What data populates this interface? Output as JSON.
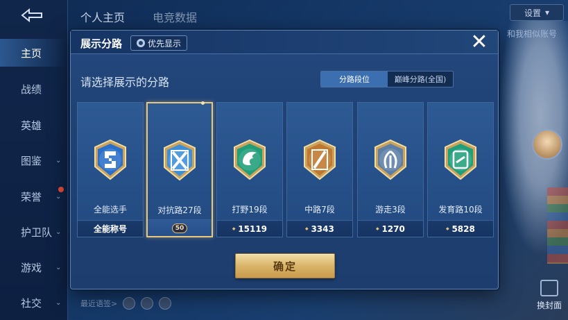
{
  "sidebar": {
    "items": [
      {
        "label": "主页",
        "active": true
      },
      {
        "label": "战绩"
      },
      {
        "label": "英雄"
      },
      {
        "label": "图鉴",
        "chevron": true
      },
      {
        "label": "荣誉",
        "chevron": true,
        "dot": true
      },
      {
        "label": "护卫队",
        "chevron": true
      },
      {
        "label": "游戏",
        "chevron": true
      },
      {
        "label": "社交",
        "chevron": true
      }
    ]
  },
  "background": {
    "tabs": [
      "个人主页",
      "电竞数据"
    ],
    "setting_label": "设置",
    "right_label": "和我相似账号",
    "recent_label": "最近语签>",
    "cover_label": "换封面"
  },
  "modal": {
    "title": "展示分路",
    "priority_label": "优先显示",
    "subtitle": "请选择展示的分路",
    "segment": {
      "active": "分路段位",
      "inactive": "巅峰分路(全国)"
    },
    "confirm_label": "确定",
    "close_glyph": "✕",
    "cards": [
      {
        "name": "全能选手",
        "footer": "全能称号",
        "badge": "allround",
        "color": "#2a6fc9",
        "selected": false
      },
      {
        "name": "对抗路27段",
        "footer": "50",
        "badge": "clash",
        "color": "#3d8fd8",
        "selected": true
      },
      {
        "name": "打野19段",
        "footer": "15119",
        "badge": "jungle",
        "color": "#1f9e78",
        "selected": false
      },
      {
        "name": "中路7段",
        "footer": "3343",
        "badge": "mid",
        "color": "#c0782e",
        "selected": false
      },
      {
        "name": "游走3段",
        "footer": "1270",
        "badge": "roam",
        "color": "#5d7fa6",
        "selected": false
      },
      {
        "name": "发育路10段",
        "footer": "5828",
        "badge": "farm",
        "color": "#20a07a",
        "selected": false
      }
    ]
  }
}
